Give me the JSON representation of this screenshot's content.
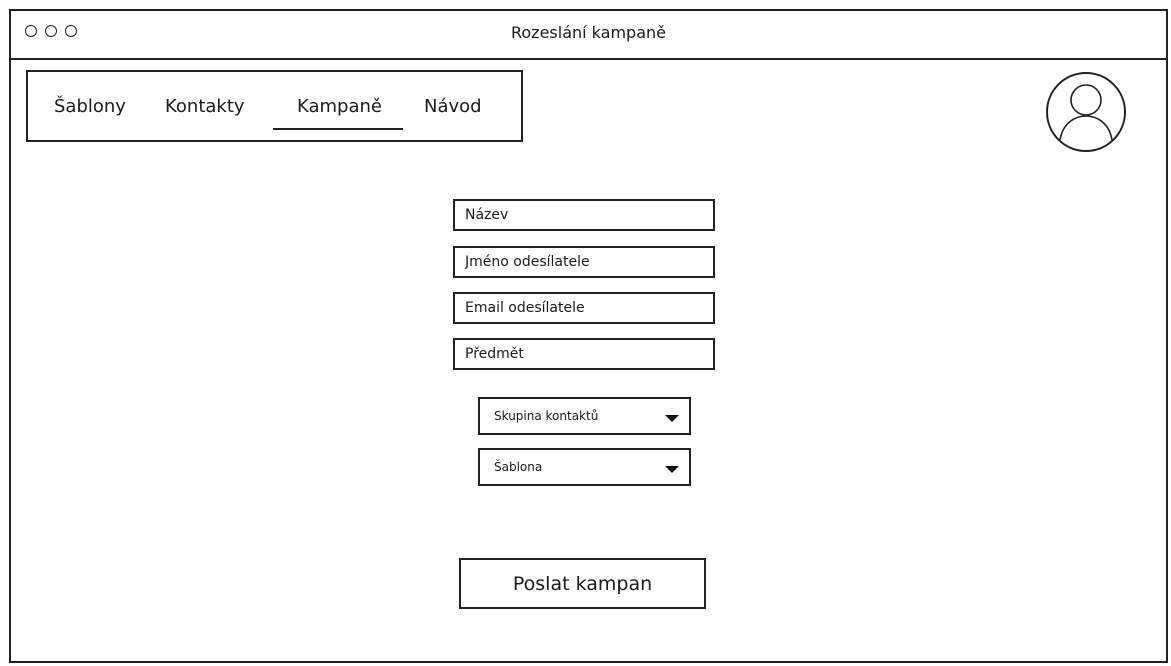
{
  "window": {
    "title": "Rozeslání kampaně"
  },
  "nav": {
    "items": [
      {
        "label": "Šablony"
      },
      {
        "label": "Kontakty"
      },
      {
        "label": "Kampaně",
        "active": true
      },
      {
        "label": "Návod"
      }
    ]
  },
  "form": {
    "fields": [
      {
        "placeholder": "Název"
      },
      {
        "placeholder": "Jméno odesílatele"
      },
      {
        "placeholder": "Email odesílatele"
      },
      {
        "placeholder": "Předmět"
      }
    ],
    "selects": [
      {
        "label": "Skupina kontaktů"
      },
      {
        "label": "Šablona"
      }
    ],
    "submit_label": "Poslat kampan"
  }
}
